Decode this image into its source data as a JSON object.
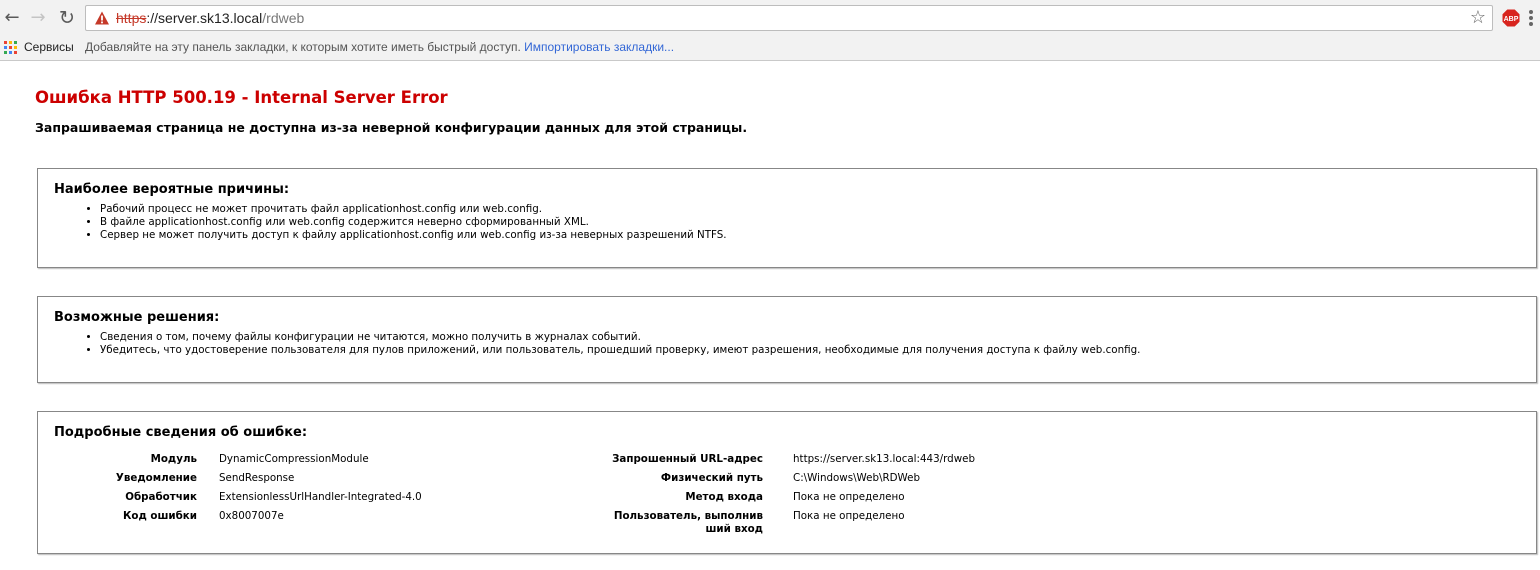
{
  "browser": {
    "url_scheme": "https",
    "url_host": "://server.sk13.local",
    "url_path": "/rdweb",
    "back_glyph": "←",
    "forward_glyph": "→",
    "reload_glyph": "↻",
    "star_glyph": "☆",
    "abp_label": "ABP",
    "icons": [
      "back-icon",
      "forward-icon",
      "reload-icon",
      "not-secure-warning-icon",
      "bookmark-star-icon",
      "adblock-plus-icon",
      "menu-icon",
      "apps-icon"
    ],
    "colors": {
      "not_secure": "#c53929",
      "adblock": "#d8241e",
      "link": "#3367d6"
    }
  },
  "bookmarks": {
    "apps_label": "Сервисы",
    "hint": "Добавляйте на эту панель закладки, к которым хотите иметь быстрый доступ.",
    "import_link": "Импортировать закладки..."
  },
  "page": {
    "title": "Ошибка HTTP 500.19 - Internal Server Error",
    "subtitle": "Запрашиваемая страница не доступна из-за неверной конфигурации данных для этой страницы.",
    "causes": {
      "heading": "Наиболее вероятные причины:",
      "items": [
        "Рабочий процесс не может прочитать файл applicationhost.config или web.config.",
        "В файле applicationhost.config или web.config содержится неверно сформированный XML.",
        "Сервер не может получить доступ к файлу applicationhost.config или web.config из-за неверных разрешений NTFS."
      ]
    },
    "solutions": {
      "heading": "Возможные решения:",
      "items": [
        "Сведения о том, почему файлы конфигурации не читаются, можно получить в журналах событий.",
        "Убедитесь, что удостоверение пользователя для пулов приложений, или пользователь, прошедший проверку, имеют разрешения, необходимые для получения доступа к файлу web.config."
      ]
    },
    "details": {
      "heading": "Подробные сведения об ошибке:",
      "left": [
        {
          "label": "Модуль",
          "value": "DynamicCompressionModule"
        },
        {
          "label": "Уведомление",
          "value": "SendResponse"
        },
        {
          "label": "Обработчик",
          "value": "ExtensionlessUrlHandler-Integrated-4.0"
        },
        {
          "label": "Код ошибки",
          "value": "0x8007007e"
        }
      ],
      "right": [
        {
          "label": "Запрошенный URL-адрес",
          "value": "https://server.sk13.local:443/rdweb"
        },
        {
          "label": "Физический путь",
          "value": "C:\\Windows\\Web\\RDWeb"
        },
        {
          "label": "Метод входа",
          "value": "Пока не определено"
        },
        {
          "label": "Пользователь, выполнив\nший вход",
          "value": "Пока не определено"
        }
      ]
    },
    "colors": {
      "title": "#cc0000",
      "border": "#878787"
    }
  }
}
